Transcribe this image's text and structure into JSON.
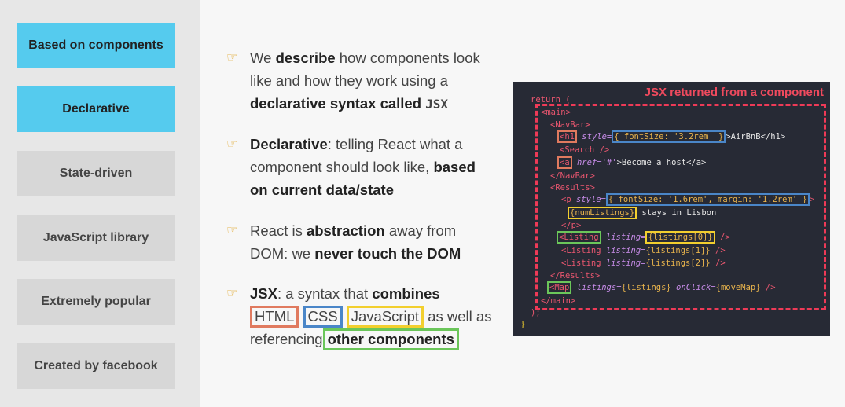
{
  "sidebar": {
    "items": [
      {
        "label": "Based on components"
      },
      {
        "label": "Declarative"
      },
      {
        "label": "State-driven"
      },
      {
        "label": "JavaScript library"
      },
      {
        "label": "Extremely popular"
      },
      {
        "label": "Created by facebook"
      }
    ]
  },
  "colors": {
    "active": "#55cbee",
    "sidebar_bg": "#e7e7e7",
    "item_bg": "#d7d7d7",
    "code_bg": "#272a35",
    "code_title": "#f04a5e"
  },
  "bullets": {
    "b1": {
      "p1": "We ",
      "p2": "describe",
      "p3": " how components look like and how they work using a ",
      "p4": "declarative syntax called ",
      "p5": "JSX"
    },
    "b2": {
      "p1": "Declarative",
      "p2": ": telling React what a component should look like, ",
      "p3": "based on current data/state"
    },
    "b3": {
      "p1": "React is ",
      "p2": "abstraction",
      "p3": " away from DOM: we ",
      "p4": "never touch the DOM"
    },
    "b4": {
      "p1": "JSX",
      "p2": ": a syntax that ",
      "p3": "combines",
      "html": "HTML",
      "css": "CSS",
      "js": "JavaScript",
      "p4": " as well as referencing",
      "p5": "other components"
    }
  },
  "code_panel": {
    "title": "JSX returned from a component",
    "lines": {
      "l1": "return (",
      "l2": "<main>",
      "l3": "<NavBar>",
      "l4a": "<h1",
      "l4b": " style=",
      "l4c": "{ fontSize: '3.2rem' }",
      "l4d": ">AirBnB</h1>",
      "l5": "<Search />",
      "l6a": "<a",
      "l6b": " href='#'",
      "l6c": ">Become a host</a>",
      "l7": "</NavBar>",
      "l8": "<Results>",
      "l9a": "<p",
      "l9b": " style=",
      "l9c": "{ fontSize: '1.6rem', margin: '1.2rem' }",
      "l9d": ">",
      "l10a": "{numListings}",
      "l10b": " stays in Lisbon",
      "l11": "</p>",
      "l12a": "<Listing",
      "l12b": " listing=",
      "l12c": "{listings[0]}",
      "l12d": " />",
      "l13a": "<Listing",
      "l13b": " listing=",
      "l13c": "{listings[1]}",
      "l13d": " />",
      "l14a": "<Listing",
      "l14b": " listing=",
      "l14c": "{listings[2]}",
      "l14d": " />",
      "l15": "</Results>",
      "l16a": "<Map",
      "l16b": " listings=",
      "l16c": "{listings}",
      "l16d": " onClick=",
      "l16e": "{moveMap}",
      "l16f": " />",
      "l17": "</main>",
      "l18": ");",
      "l19": "}"
    }
  }
}
